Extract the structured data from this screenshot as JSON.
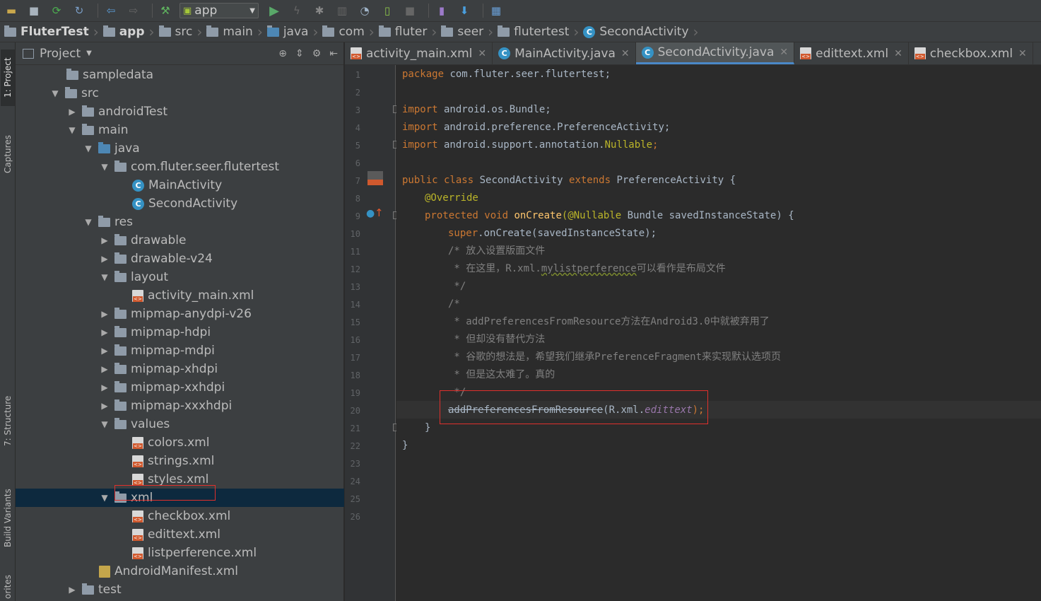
{
  "toolbar": {
    "run_config": "app"
  },
  "breadcrumb": {
    "items": [
      "FluterTest",
      "app",
      "src",
      "main",
      "java",
      "com",
      "fluter",
      "seer",
      "flutertest",
      "SecondActivity"
    ]
  },
  "left_strip": {
    "project": "1: Project",
    "captures": "Captures",
    "structure": "7: Structure",
    "build_variants": "Build Variants",
    "favorites": "orites"
  },
  "project_panel": {
    "title": "Project",
    "tree": [
      {
        "label": "sampledata"
      },
      {
        "label": "src"
      },
      {
        "label": "androidTest"
      },
      {
        "label": "main"
      },
      {
        "label": "java"
      },
      {
        "label": "com.fluter.seer.flutertest"
      },
      {
        "label": "MainActivity"
      },
      {
        "label": "SecondActivity"
      },
      {
        "label": "res"
      },
      {
        "label": "drawable"
      },
      {
        "label": "drawable-v24"
      },
      {
        "label": "layout"
      },
      {
        "label": "activity_main.xml"
      },
      {
        "label": "mipmap-anydpi-v26"
      },
      {
        "label": "mipmap-hdpi"
      },
      {
        "label": "mipmap-mdpi"
      },
      {
        "label": "mipmap-xhdpi"
      },
      {
        "label": "mipmap-xxhdpi"
      },
      {
        "label": "mipmap-xxxhdpi"
      },
      {
        "label": "values"
      },
      {
        "label": "colors.xml"
      },
      {
        "label": "strings.xml"
      },
      {
        "label": "styles.xml"
      },
      {
        "label": "xml"
      },
      {
        "label": "checkbox.xml"
      },
      {
        "label": "edittext.xml"
      },
      {
        "label": "listperference.xml"
      },
      {
        "label": "AndroidManifest.xml"
      },
      {
        "label": "test"
      }
    ]
  },
  "tabs": [
    {
      "label": "activity_main.xml"
    },
    {
      "label": "MainActivity.java"
    },
    {
      "label": "SecondActivity.java"
    },
    {
      "label": "edittext.xml"
    },
    {
      "label": "checkbox.xml"
    }
  ],
  "editor": {
    "line_numbers": [
      "1",
      "2",
      "3",
      "4",
      "5",
      "6",
      "7",
      "8",
      "9",
      "10",
      "11",
      "12",
      "13",
      "14",
      "15",
      "16",
      "17",
      "18",
      "19",
      "20",
      "21",
      "22",
      "23",
      "24",
      "25",
      "26"
    ],
    "code": {
      "l1_kw": "package",
      "l1_rest": " com.fluter.seer.flutertest;",
      "import_kw": "import",
      "l3_rest": " android.os.Bundle;",
      "l4_rest": " android.preference.PreferenceActivity;",
      "l5_rest": " android.support.annotation.",
      "l5_ann": "Nullable",
      "l5_end": ";",
      "l7_kw1": "public class",
      "l7_name": " SecondActivity ",
      "l7_kw2": "extends",
      "l7_rest": " PreferenceActivity {",
      "l8_ann": "@Override",
      "l9_kw": "protected void",
      "l9_fn": "onCreate",
      "l9_ann": "(@Nullable",
      "l9_rest": " Bundle savedInstanceState) {",
      "l10_kw": "super",
      "l10_rest": ".onCreate(savedInstanceState);",
      "l11": "/* 放入设置版面文件",
      "l12_a": " * 在这里，R.xml.",
      "l12_b": "mylistperference",
      "l12_c": "可以看作是布局文件",
      "l13": " */",
      "l14": "/*",
      "l15": " * addPreferencesFromResource方法在Android3.0中就被弃用了",
      "l16": " * 但却没有替代方法",
      "l17": " * 谷歌的想法是，希望我们继承PreferenceFragment来实现默认选项页",
      "l18": " * 但是这太难了。真的",
      "l19": " */",
      "l20_strike": "addPreferencesFromResource",
      "l20_mid": "(R.xml.",
      "l20_it": "edittext",
      "l20_end": ");",
      "l21": "}",
      "l22": "}"
    }
  }
}
